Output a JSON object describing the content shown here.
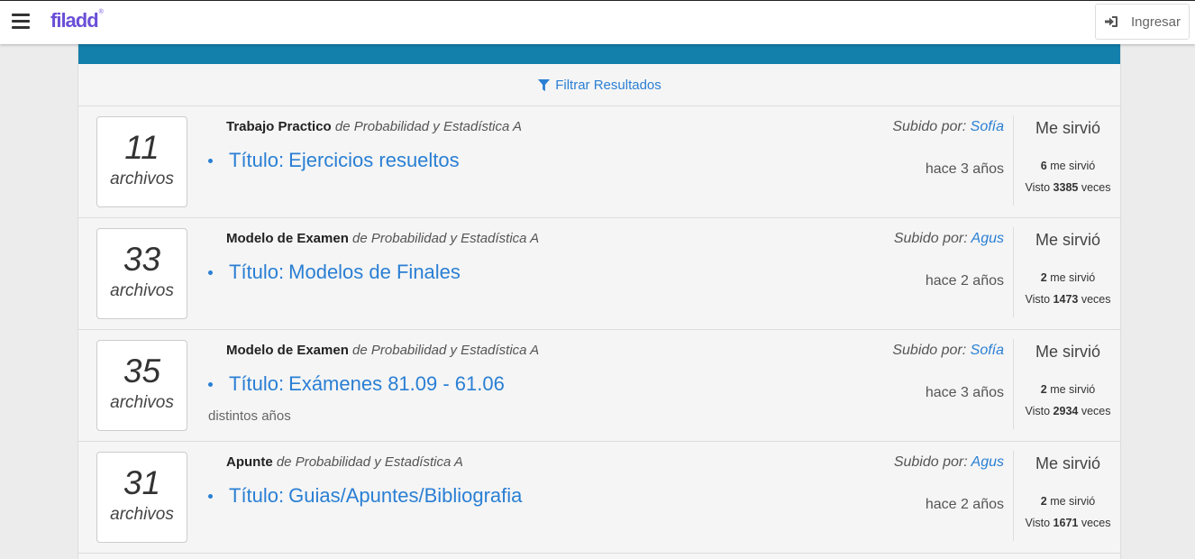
{
  "header": {
    "logo": "filadd",
    "logo_mark": "®",
    "login_label": "Ingresar"
  },
  "filter": {
    "label": "Filtrar Resultados"
  },
  "items": [
    {
      "count": "11",
      "count_label": "archivos",
      "type": "Trabajo Practico",
      "subject": "de Probabilidad y Estadística A",
      "title_prefix": "Título:",
      "title": "Ejercicios resueltos",
      "description": "",
      "uploaded_by_label": "Subido por:",
      "uploader": "Sofía",
      "ago": "hace 3 años",
      "helpful_label": "Me sirvió",
      "helpful_count": "6",
      "helpful_suffix": "me sirvió",
      "views_prefix": "Visto",
      "views": "3385",
      "views_suffix": "veces"
    },
    {
      "count": "33",
      "count_label": "archivos",
      "type": "Modelo de Examen",
      "subject": "de Probabilidad y Estadística A",
      "title_prefix": "Título:",
      "title": "Modelos de Finales",
      "description": "",
      "uploaded_by_label": "Subido por:",
      "uploader": "Agus",
      "ago": "hace 2 años",
      "helpful_label": "Me sirvió",
      "helpful_count": "2",
      "helpful_suffix": "me sirvió",
      "views_prefix": "Visto",
      "views": "1473",
      "views_suffix": "veces"
    },
    {
      "count": "35",
      "count_label": "archivos",
      "type": "Modelo de Examen",
      "subject": "de Probabilidad y Estadística A",
      "title_prefix": "Título:",
      "title": "Exámenes 81.09 - 61.06",
      "description": "distintos años",
      "uploaded_by_label": "Subido por:",
      "uploader": "Sofía",
      "ago": "hace 3 años",
      "helpful_label": "Me sirvió",
      "helpful_count": "2",
      "helpful_suffix": "me sirvió",
      "views_prefix": "Visto",
      "views": "2934",
      "views_suffix": "veces"
    },
    {
      "count": "31",
      "count_label": "archivos",
      "type": "Apunte",
      "subject": "de Probabilidad y Estadística A",
      "title_prefix": "Título:",
      "title": "Guias/Apuntes/Bibliografia",
      "description": "",
      "uploaded_by_label": "Subido por:",
      "uploader": "Agus",
      "ago": "hace 2 años",
      "helpful_label": "Me sirvió",
      "helpful_count": "2",
      "helpful_suffix": "me sirvió",
      "views_prefix": "Visto",
      "views": "1671",
      "views_suffix": "veces"
    }
  ],
  "colors": {
    "brand": "#6a4fd6",
    "link": "#2a7fd4",
    "strip": "#137fab"
  },
  "icons": {
    "menu": "hamburger-icon",
    "login": "sign-in-icon",
    "filter": "funnel-icon"
  }
}
